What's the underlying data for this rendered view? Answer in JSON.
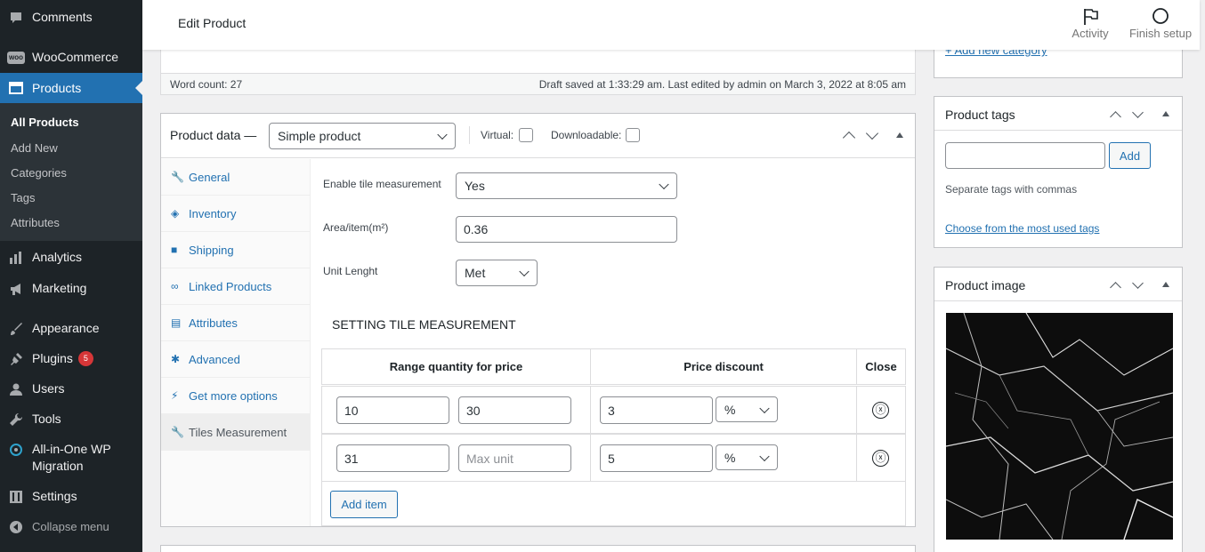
{
  "sidebar": {
    "comments": "Comments",
    "woocommerce": "WooCommerce",
    "woo_icon_text": "woo",
    "products": "Products",
    "submenu": [
      "All Products",
      "Add New",
      "Categories",
      "Tags",
      "Attributes"
    ],
    "analytics": "Analytics",
    "marketing": "Marketing",
    "appearance": "Appearance",
    "plugins": "Plugins",
    "plugins_badge": "5",
    "users": "Users",
    "tools": "Tools",
    "migration_line1": "All-in-One WP",
    "migration_line2": "Migration",
    "settings": "Settings",
    "collapse": "Collapse menu"
  },
  "header": {
    "title": "Edit Product",
    "activity": "Activity",
    "finish_setup": "Finish setup"
  },
  "editor": {
    "word_count": "Word count: 27",
    "draft_status": "Draft saved at 1:33:29 am. Last edited by admin on March 3, 2022 at 8:05 am"
  },
  "product_data": {
    "label": "Product data —",
    "type_selected": "Simple product",
    "virtual_label": "Virtual:",
    "downloadable_label": "Downloadable:",
    "tabs": [
      "General",
      "Inventory",
      "Shipping",
      "Linked Products",
      "Attributes",
      "Advanced",
      "Get more options",
      "Tiles Measurement"
    ],
    "active_tab_index": 7,
    "fields": {
      "enable_label": "Enable tile measurement",
      "enable_value": "Yes",
      "area_label": "Area/item(m²)",
      "area_value": "0.36",
      "unit_label": "Unit Lenght",
      "unit_value": "Met"
    },
    "section_title": "SETTING TILE MEASUREMENT",
    "table": {
      "headers": [
        "Range quantity for price",
        "Price discount",
        "Close"
      ],
      "rows": [
        {
          "min": "10",
          "max": "30",
          "max_placeholder": "",
          "discount": "3",
          "unit": "%"
        },
        {
          "min": "31",
          "max": "",
          "max_placeholder": "Max unit",
          "discount": "5",
          "unit": "%"
        }
      ],
      "close_glyph": "ⓧ"
    },
    "add_item": "Add item"
  },
  "side": {
    "add_new_category": "+ Add new category",
    "tags_title": "Product tags",
    "tags_add": "Add",
    "tags_hint": "Separate tags with commas",
    "tags_most_used": "Choose from the most used tags",
    "image_title": "Product image"
  }
}
